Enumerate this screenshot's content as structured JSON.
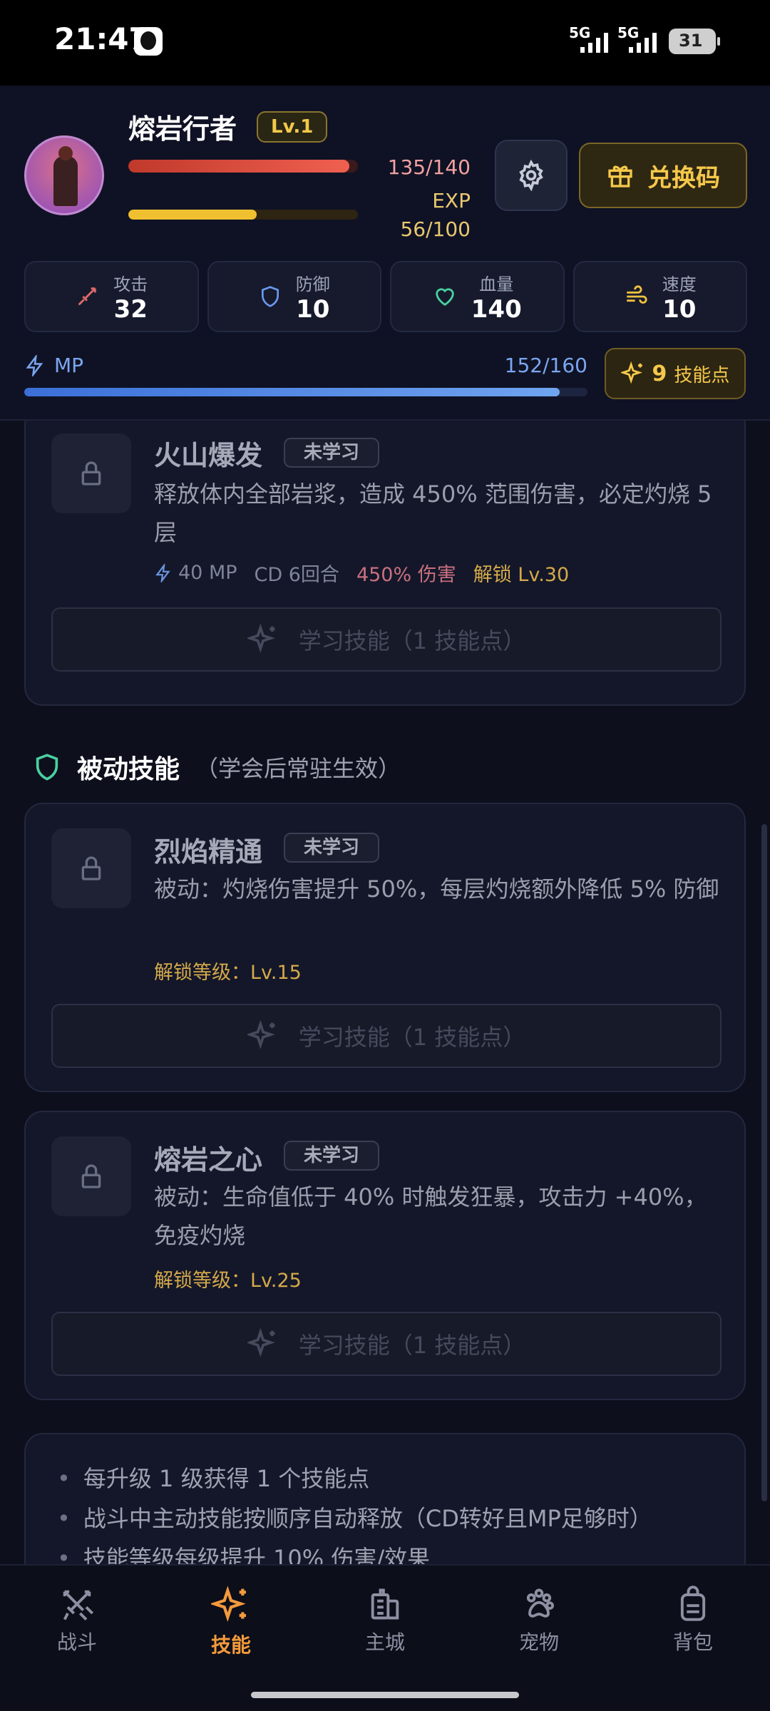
{
  "status_bar": {
    "time": "21:47",
    "net1": "5G",
    "net2": "5G",
    "battery": "31"
  },
  "player": {
    "name": "熔岩行者",
    "level": "Lv.1",
    "hp_text": "135/140",
    "hp_fraction": 0.964,
    "exp_label": "EXP",
    "exp_text": "56/100",
    "exp_fraction": 0.56
  },
  "header": {
    "redeem_label": "兑换码"
  },
  "stats": [
    {
      "label": "攻击",
      "value": "32",
      "icon": "sword-icon",
      "color": "#e06a6a"
    },
    {
      "label": "防御",
      "value": "10",
      "icon": "shield-icon",
      "color": "#6a9af0"
    },
    {
      "label": "血量",
      "value": "140",
      "icon": "heart-icon",
      "color": "#4ad0a0"
    },
    {
      "label": "速度",
      "value": "10",
      "icon": "wind-icon",
      "color": "#f0c040"
    }
  ],
  "mp": {
    "label": "MP",
    "value": "152/160",
    "fraction": 0.95
  },
  "skill_points": {
    "count": "9",
    "label": "技能点"
  },
  "skills_active": [
    {
      "name": "火山爆发",
      "status": "未学习",
      "desc": "释放体内全部岩浆，造成 450% 范围伤害，必定灼烧 5 层",
      "mp": "40 MP",
      "cd": "CD 6回合",
      "damage": "450% 伤害",
      "unlock": "解锁 Lv.30",
      "learn_label": "学习技能（1 技能点）"
    }
  ],
  "passive_section": {
    "title": "被动技能",
    "subtitle": "（学会后常驻生效）"
  },
  "skills_passive": [
    {
      "name": "烈焰精通",
      "status": "未学习",
      "desc": "被动：灼烧伤害提升 50%，每层灼烧额外降低 5% 防御",
      "unlock": "解锁等级：Lv.15",
      "learn_label": "学习技能（1 技能点）"
    },
    {
      "name": "熔岩之心",
      "status": "未学习",
      "desc": "被动：生命值低于 40% 时触发狂暴，攻击力 +40%，免疫灼烧",
      "unlock": "解锁等级：Lv.25",
      "learn_label": "学习技能（1 技能点）"
    }
  ],
  "tips": [
    "每升级 1 级获得 1 个技能点",
    "战斗中主动技能按顺序自动释放（CD转好且MP足够时）",
    "技能等级每级提升 10% 伤害/效果"
  ],
  "nav": [
    {
      "label": "战斗",
      "icon": "crossed-swords-icon",
      "active": false
    },
    {
      "label": "技能",
      "icon": "sparkles-icon",
      "active": true
    },
    {
      "label": "主城",
      "icon": "building-icon",
      "active": false
    },
    {
      "label": "宠物",
      "icon": "paw-icon",
      "active": false
    },
    {
      "label": "背包",
      "icon": "backpack-icon",
      "active": false
    }
  ],
  "colors": {
    "accent": "#f39a3c",
    "gold": "#f5c84a",
    "mp": "#6fa4f0",
    "hp": "#e04a3c"
  }
}
